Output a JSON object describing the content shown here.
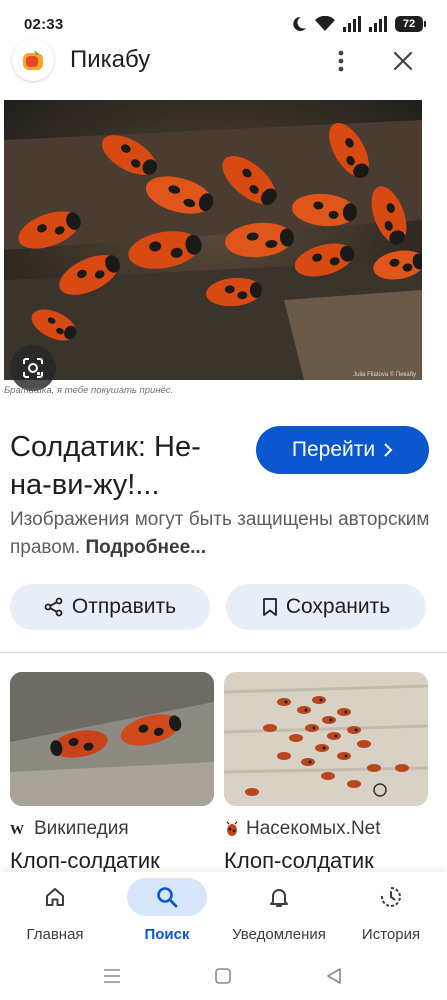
{
  "status_bar": {
    "time": "02:33",
    "battery": "72"
  },
  "header": {
    "app_title": "Пикабу",
    "logo_icon": "pikabu-logo"
  },
  "image": {
    "caption": "Братишка, я тебе покушать принёс.",
    "watermark": "Julia Filatova © Пикабу"
  },
  "result": {
    "title": "Солдатик: Не-на-ви-жу!...",
    "visit_label": "Перейти",
    "copyright_text": "Изображения могут быть защищены авторским правом.",
    "more_link": "Подробнее..."
  },
  "actions": {
    "share_label": "Отправить",
    "save_label": "Сохранить"
  },
  "related": [
    {
      "source": "Википедия",
      "title": "Клоп-солдатик"
    },
    {
      "source": "Насекомых.Net",
      "title": "Клоп-солдатик"
    }
  ],
  "bottom_nav": [
    {
      "label": "Главная",
      "icon": "home-icon",
      "active": false
    },
    {
      "label": "Поиск",
      "icon": "search-icon",
      "active": true
    },
    {
      "label": "Уведомления",
      "icon": "bell-icon",
      "active": false
    },
    {
      "label": "История",
      "icon": "history-icon",
      "active": false
    }
  ],
  "colors": {
    "accent": "#0b57d0",
    "chip_bg": "#e8eef8",
    "nav_active_bg": "#d7e5fb"
  }
}
